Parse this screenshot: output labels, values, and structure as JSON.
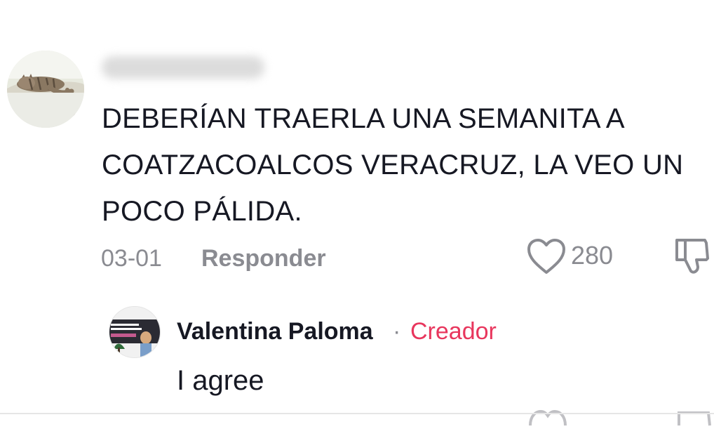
{
  "comment": {
    "username_blurred": "Gatinhodobairro",
    "text": "DEBERÍAN TRAERLA UNA SEMANITA A COATZACOALCOS VERACRUZ, LA VEO UN POCO PÁLIDA.",
    "date": "03-01",
    "reply_label": "Responder",
    "like_count": "280"
  },
  "reply": {
    "username": "Valentina Paloma",
    "separator": "·",
    "badge": "Creador",
    "text": "I agree"
  },
  "icons": {
    "avatar_main": "cat-avatar",
    "avatar_reply": "profile-photo-avatar",
    "like": "heart-icon",
    "dislike": "thumbs-down-icon"
  },
  "colors": {
    "text_primary": "#161823",
    "text_secondary": "#8a8b91",
    "creator_accent": "#e8365d"
  }
}
